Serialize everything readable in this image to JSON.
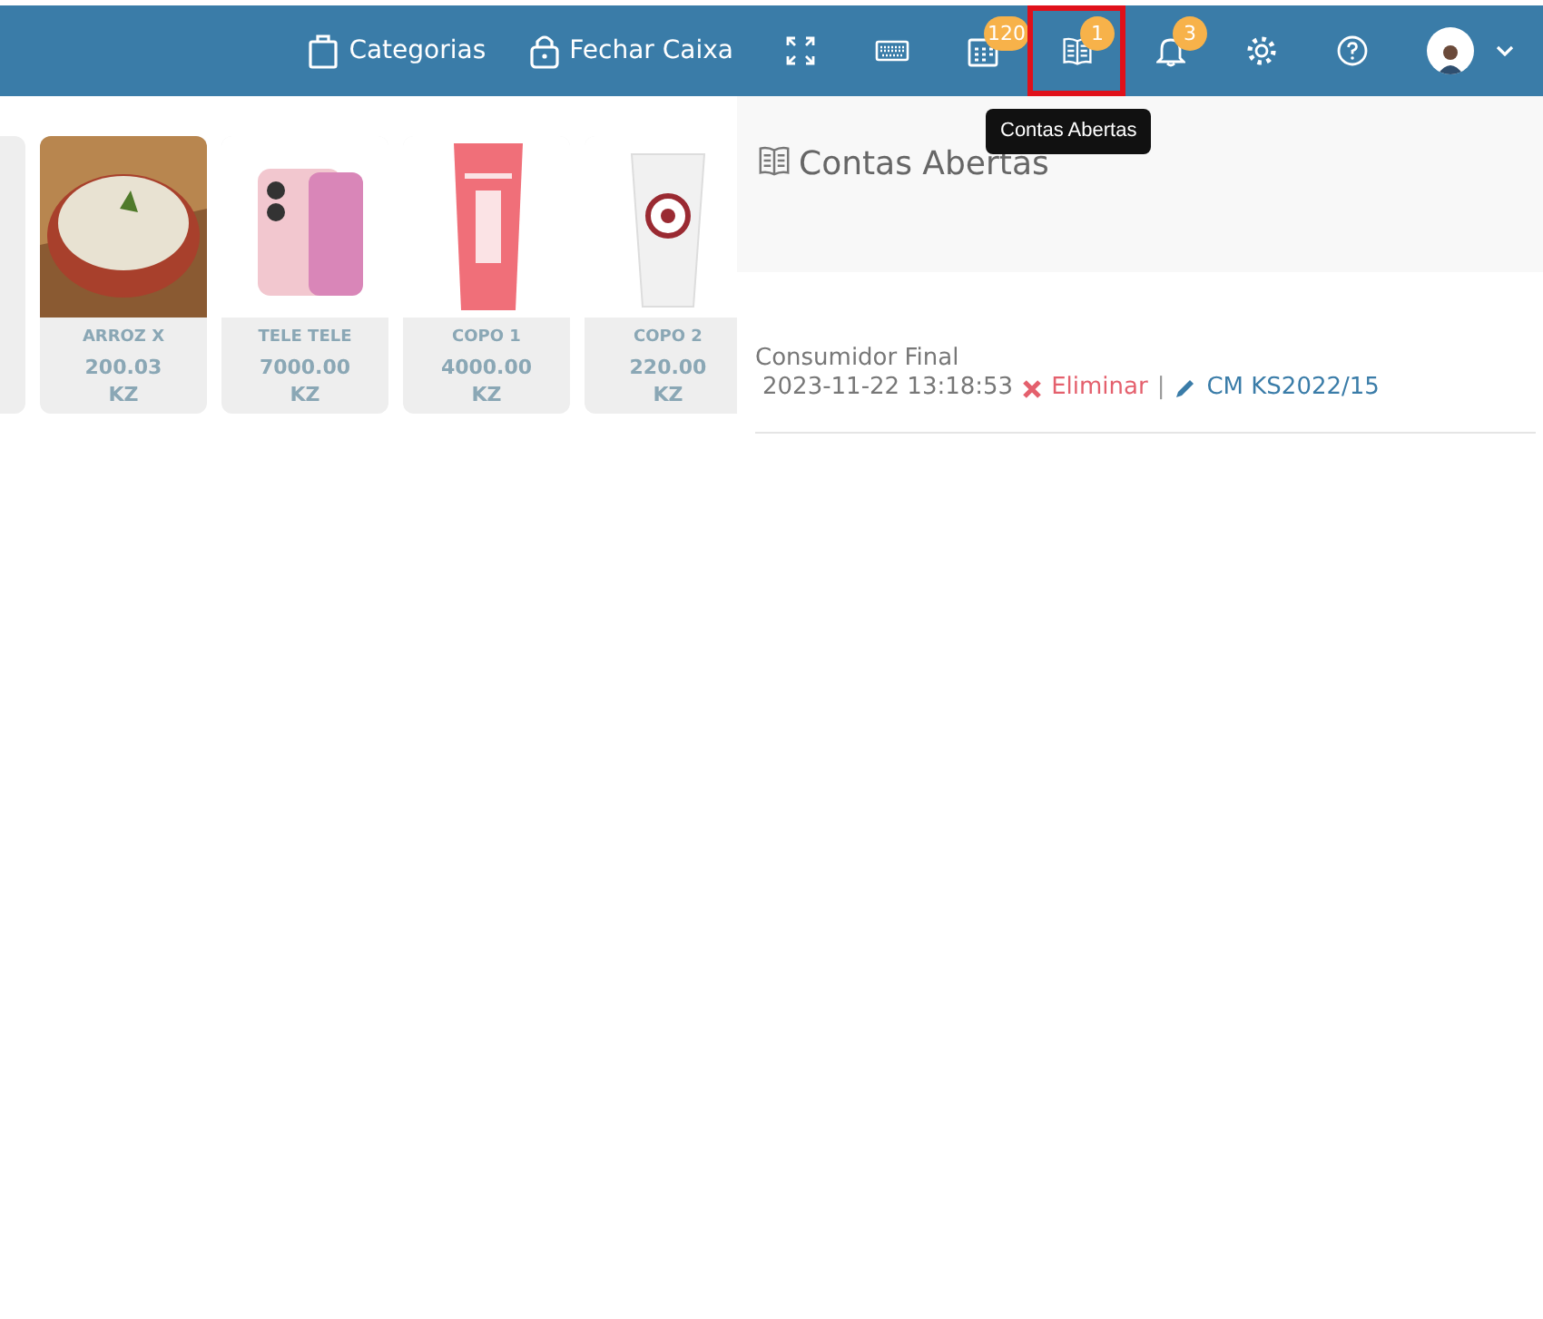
{
  "header": {
    "links": [
      {
        "kind": "bag",
        "label": "Categorias"
      },
      {
        "kind": "lock",
        "label": "Fechar Caixa"
      }
    ],
    "icons": [
      {
        "kind": "expand",
        "selected": false
      },
      {
        "kind": "keyboard",
        "selected": false
      },
      {
        "kind": "calendar",
        "badge": "120",
        "selected": false
      },
      {
        "kind": "book",
        "badge": "1",
        "selected": true
      },
      {
        "kind": "bell",
        "badge": "3",
        "selected": false
      },
      {
        "kind": "gear",
        "selected": false
      },
      {
        "kind": "help",
        "selected": false
      }
    ],
    "tooltip": "Contas Abertas"
  },
  "products": [
    {
      "name": "ARROZ X",
      "price": "200.03",
      "currency": "KZ"
    },
    {
      "name": "TELE TELE",
      "price": "7000.00",
      "currency": "KZ"
    },
    {
      "name": "COPO 1",
      "price": "4000.00",
      "currency": "KZ"
    },
    {
      "name": "COPO 2",
      "price": "220.00",
      "currency": "KZ"
    }
  ],
  "panel": {
    "title": "Contas Abertas",
    "accounts": [
      {
        "customer": "Consumidor Final",
        "date": "2023-11-22 13:18:53",
        "delete": "Eliminar",
        "separator": "|",
        "reference": "CM KS2022/15"
      }
    ]
  }
}
